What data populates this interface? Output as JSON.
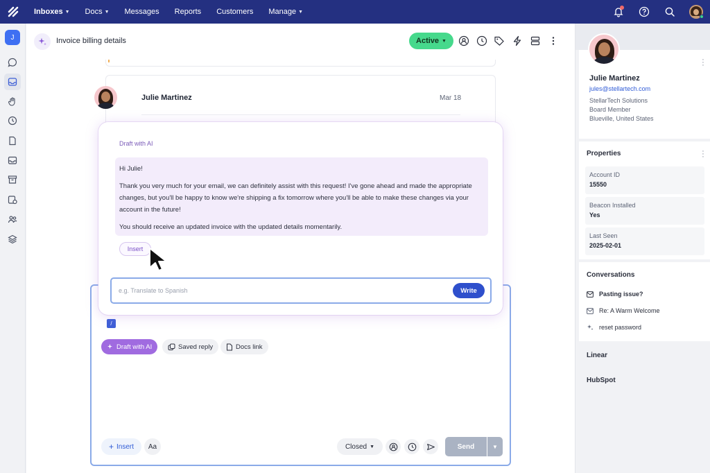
{
  "topnav": {
    "items": [
      {
        "label": "Inboxes",
        "has_caret": true
      },
      {
        "label": "Docs",
        "has_caret": true
      },
      {
        "label": "Messages",
        "has_caret": false
      },
      {
        "label": "Reports",
        "has_caret": false
      },
      {
        "label": "Customers",
        "has_caret": false
      },
      {
        "label": "Manage",
        "has_caret": true
      }
    ],
    "icons": [
      "bell-icon",
      "help-icon",
      "search-icon",
      "user-avatar"
    ]
  },
  "rail": {
    "avatar_initial": "J",
    "icons": [
      "chat-icon",
      "inbox-icon",
      "hand-icon",
      "clock-icon",
      "document-icon",
      "mailbox-icon",
      "archive-icon",
      "filter-icon",
      "people-icon",
      "layers-icon"
    ],
    "active_index": 1
  },
  "conversation": {
    "title": "Invoice billing details",
    "status": "Active",
    "header_icons": [
      "assign-icon",
      "snooze-icon",
      "tag-icon",
      "workflow-icon",
      "layout-icon",
      "more-icon"
    ],
    "message": {
      "author": "Julie Martinez",
      "date": "Mar 18"
    }
  },
  "ai_panel": {
    "label": "Draft with AI",
    "draft": [
      "Hi Julie!",
      "Thank you very much for your email, we can definitely assist with this request! I've gone ahead and made the appropriate changes, but you'll be happy to know we're shipping a fix tomorrow where you'll be able to make these changes via your account in the future!",
      "You should receive an updated invoice with the updated details momentarily."
    ],
    "insert_label": "Insert",
    "prompt_placeholder": "e.g. Translate to Spanish",
    "prompt_value": "",
    "write_label": "Write"
  },
  "composer": {
    "slash": "/",
    "chips": [
      {
        "label": "Draft with AI",
        "icon": "sparkle-icon"
      },
      {
        "label": "Saved reply",
        "icon": "saved-reply-icon"
      },
      {
        "label": "Docs link",
        "icon": "docs-link-icon"
      }
    ],
    "insert_label": "Insert",
    "format_label": "Aa",
    "status_label": "Closed",
    "send_label": "Send",
    "colors": {
      "send_disabled": "#aab3c3",
      "ai_chip": "#a06be0"
    }
  },
  "sidebar": {
    "customer": {
      "name": "Julie Martinez",
      "email": "jules@stellartech.com",
      "company": "StellarTech Solutions",
      "role": "Board Member",
      "location": "Blueville, United States"
    },
    "properties_title": "Properties",
    "properties": [
      {
        "label": "Account ID",
        "value": "15550"
      },
      {
        "label": "Beacon Installed",
        "value": "Yes"
      },
      {
        "label": "Last Seen",
        "value": "2025-02-01"
      }
    ],
    "conversations_title": "Conversations",
    "conversations": [
      {
        "title": "Pasting issue?",
        "icon": "envelope-icon",
        "unread": true
      },
      {
        "title": "Re: A Warm Welcome",
        "icon": "envelope-icon",
        "unread": false
      },
      {
        "title": "reset password",
        "icon": "sparkle-icon",
        "unread": false
      }
    ],
    "integrations": [
      "Linear",
      "HubSpot"
    ]
  },
  "theme": {
    "nav_bg": "#243081",
    "accent": "#2e4fcc",
    "active_green": "#46d98c",
    "ai_purple": "#7a4fc6"
  }
}
